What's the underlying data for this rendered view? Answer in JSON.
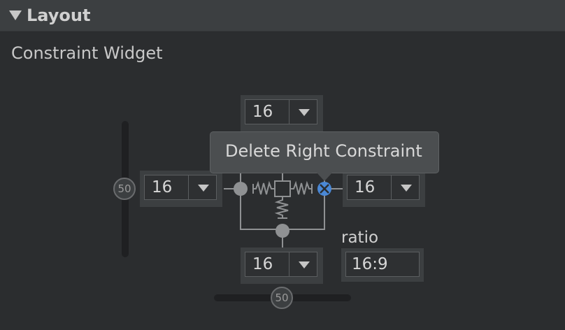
{
  "header": {
    "title": "Layout",
    "arrow_icon": "triangle-down-icon"
  },
  "section": {
    "title": "Constraint Widget"
  },
  "margins": {
    "top": "16",
    "left": "16",
    "right": "16",
    "bottom": "16"
  },
  "bias": {
    "vertical": "50",
    "horizontal": "50"
  },
  "ratio": {
    "label": "ratio",
    "value": "16:9"
  },
  "tooltip": {
    "text": "Delete Right Constraint"
  },
  "colors": {
    "background": "#2b2d2f",
    "panel": "#3c3f41",
    "accent_delete": "#4a88d6"
  }
}
